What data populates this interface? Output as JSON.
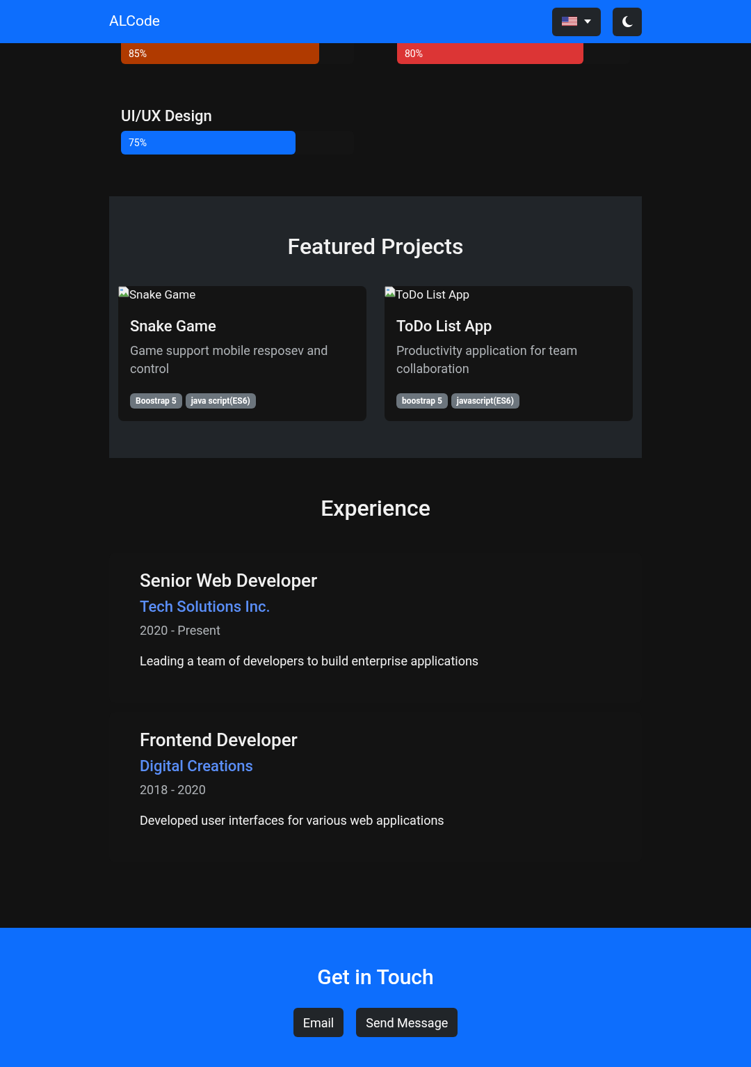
{
  "navbar": {
    "brand": "ALCode",
    "language_button": {
      "expanded": false
    },
    "theme_button": {
      "kind": "dark"
    }
  },
  "skills": [
    {
      "level": 0.85,
      "reading": "85%",
      "color": "#b03a00"
    },
    {
      "level": 0.8,
      "reading": "80%",
      "color": "#dc3535"
    },
    {
      "name": "UI/UX Design",
      "level": 0.75,
      "reading": "75%",
      "color": "#0d6efd"
    }
  ],
  "projects": {
    "title": "Featured Projects",
    "items": [
      {
        "image_alt": "Snake Game",
        "title": "Snake Game",
        "description": "Game support mobile resposev and control",
        "tags": [
          "Boostrap 5",
          "java script(ES6)"
        ]
      },
      {
        "image_alt": "ToDo List App",
        "title": "ToDo List App",
        "description": "Productivity application for team collaboration",
        "tags": [
          "boostrap 5",
          "javascript(ES6)"
        ]
      }
    ]
  },
  "experience": {
    "title": "Experience",
    "items": [
      {
        "role": "Senior Web Developer",
        "company": "Tech Solutions Inc.",
        "period": "2020 - Present",
        "description": "Leading a team of developers to build enterprise applications"
      },
      {
        "role": "Frontend Developer",
        "company": "Digital Creations",
        "period": "2018 - 2020",
        "description": "Developed user interfaces for various web applications"
      }
    ]
  },
  "contact": {
    "title": "Get in Touch",
    "buttons": [
      "Email",
      "Send Message"
    ]
  }
}
